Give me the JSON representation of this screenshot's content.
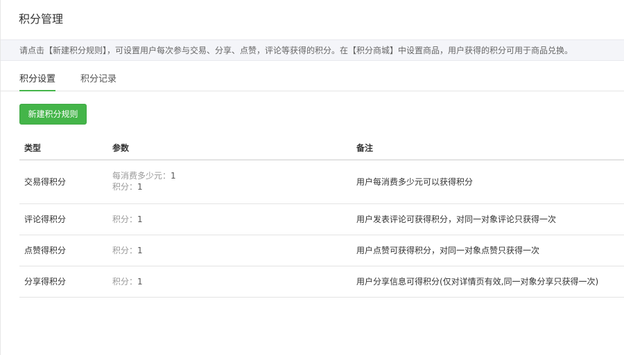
{
  "page": {
    "title": "积分管理"
  },
  "notice": {
    "text": "请点击【新建积分规则】，可设置用户每次参与交易、分享、点赞，评论等获得的积分。在【积分商城】中设置商品，用户获得的积分可用于商品兑换。"
  },
  "tabs": [
    {
      "label": "积分设置",
      "active": true
    },
    {
      "label": "积分记录",
      "active": false
    }
  ],
  "toolbar": {
    "new_rule_label": "新建积分规则"
  },
  "table": {
    "headers": [
      "类型",
      "参数",
      "备注"
    ],
    "rows": [
      {
        "type": "交易得积分",
        "params": [
          {
            "label": "每消费多少元：",
            "value": "1"
          },
          {
            "label": "积分：",
            "value": "1"
          }
        ],
        "remark": "用户每消费多少元可以获得积分"
      },
      {
        "type": "评论得积分",
        "params": [
          {
            "label": "积分：",
            "value": "1"
          }
        ],
        "remark": "用户发表评论可获得积分，对同一对象评论只获得一次"
      },
      {
        "type": "点赞得积分",
        "params": [
          {
            "label": "积分：",
            "value": "1"
          }
        ],
        "remark": "用户点赞可获得积分，对同一对象点赞只获得一次"
      },
      {
        "type": "分享得积分",
        "params": [
          {
            "label": "积分：",
            "value": "1"
          }
        ],
        "remark": "用户分享信息可得积分(仅对详情页有效,同一对象分享只获得一次)"
      }
    ]
  },
  "colors": {
    "accent": "#44b549",
    "notice_bg": "#f4f5f9",
    "muted_text": "#999999"
  }
}
